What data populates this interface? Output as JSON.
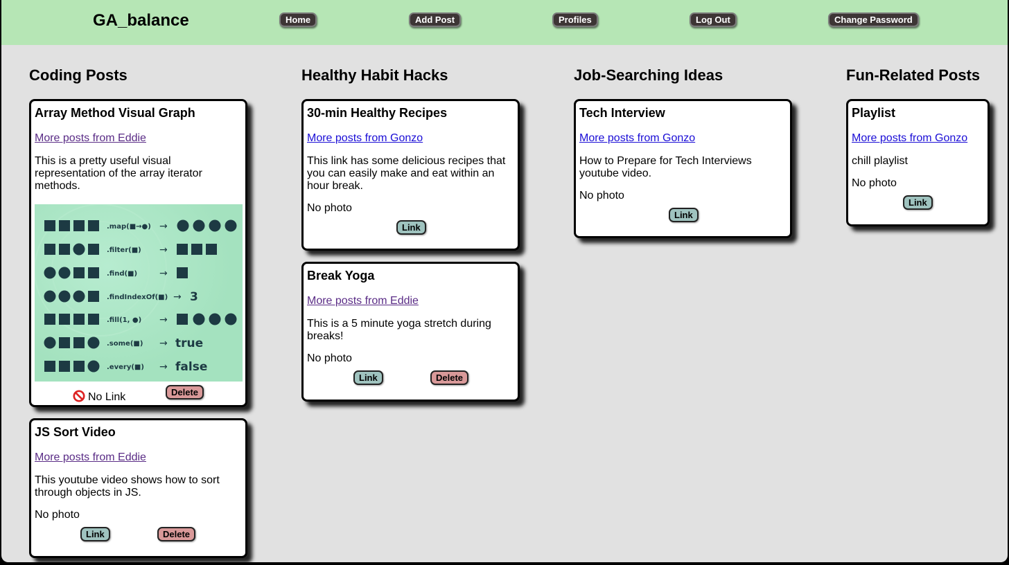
{
  "app": {
    "brand": "GA_balance"
  },
  "nav": {
    "home": "Home",
    "add_post": "Add Post",
    "profiles": "Profiles",
    "log_out": "Log Out",
    "change_password": "Change Password"
  },
  "colors": {
    "navbar": "#b6e6b5",
    "page_bg": "#e1e1e1",
    "link_btn": "#9fc3bf",
    "delete_btn": "#d99999"
  },
  "columns": [
    {
      "title": "Coding Posts",
      "posts": [
        {
          "title": "Array Method Visual Graph",
          "author_link": "More posts from Eddie",
          "body": "This is a pretty useful visual representation of the array iterator methods.",
          "no_link": "No Link",
          "delete": "Delete",
          "graph": {
            "rows": [
              {
                "method": ".map(■→●)",
                "result": ""
              },
              {
                "method": ".filter(■)",
                "result": ""
              },
              {
                "method": ".find(■)",
                "result": ""
              },
              {
                "method": ".findIndexOf(■)",
                "result": "3"
              },
              {
                "method": ".fill(1, ●)",
                "result": ""
              },
              {
                "method": ".some(■)",
                "result": "true"
              },
              {
                "method": ".every(■)",
                "result": "false"
              }
            ]
          }
        },
        {
          "title": "JS Sort Video",
          "author_link": "More posts from Eddie",
          "body": "This youtube video shows how to sort through objects in JS.",
          "photo": "No photo",
          "link": "Link",
          "delete": "Delete"
        }
      ]
    },
    {
      "title": "Healthy Habit Hacks",
      "posts": [
        {
          "title": "30-min Healthy Recipes",
          "author_link": "More posts from Gonzo",
          "body": "This link has some delicious recipes that you can easily make and eat within an hour break.",
          "photo": "No photo",
          "link": "Link"
        },
        {
          "title": "Break Yoga",
          "author_link": "More posts from Eddie",
          "body": "This is a 5 minute yoga stretch during breaks!",
          "photo": "No photo",
          "link": "Link",
          "delete": "Delete"
        }
      ]
    },
    {
      "title": "Job-Searching Ideas",
      "posts": [
        {
          "title": "Tech Interview",
          "author_link": "More posts from Gonzo",
          "body": "How to Prepare for Tech Interviews youtube video.",
          "photo": "No photo",
          "link": "Link"
        }
      ]
    },
    {
      "title": "Fun-Related Posts",
      "posts": [
        {
          "title": "Playlist",
          "author_link": "More posts from Gonzo",
          "body": "chill playlist",
          "photo": "No photo",
          "link": "Link"
        }
      ]
    }
  ]
}
